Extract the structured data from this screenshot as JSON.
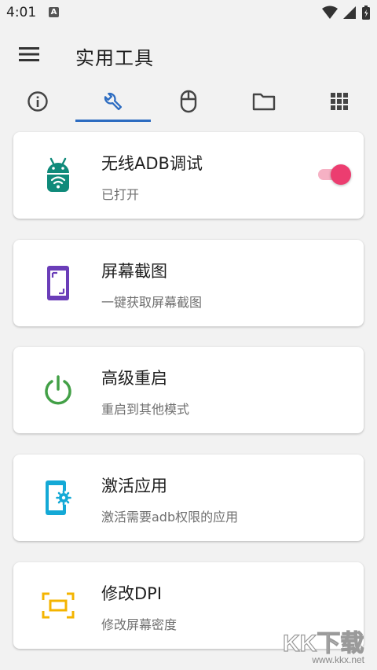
{
  "status_bar": {
    "time": "4:01",
    "notification_letter": "A"
  },
  "app_bar": {
    "title": "实用工具"
  },
  "tabs": [
    {
      "id": "info",
      "icon": "info-icon"
    },
    {
      "id": "tools",
      "icon": "wrench-icon",
      "selected": true
    },
    {
      "id": "mouse",
      "icon": "mouse-icon"
    },
    {
      "id": "files",
      "icon": "folder-icon"
    },
    {
      "id": "apps",
      "icon": "grid-icon"
    }
  ],
  "cards": [
    {
      "title": "无线ADB调试",
      "subtitle": "已打开",
      "icon": "android-wifi-icon",
      "color": "#0f8a7a",
      "toggle_on": true
    },
    {
      "title": "屏幕截图",
      "subtitle": "一键获取屏幕截图",
      "icon": "screenshot-icon",
      "color": "#6a3db8"
    },
    {
      "title": "高级重启",
      "subtitle": "重启到其他模式",
      "icon": "power-icon",
      "color": "#43a047"
    },
    {
      "title": "激活应用",
      "subtitle": "激活需要adb权限的应用",
      "icon": "phone-gear-icon",
      "color": "#14a9d6"
    },
    {
      "title": "修改DPI",
      "subtitle": "修改屏幕密度",
      "icon": "dpi-frame-icon",
      "color": "#f4b400"
    }
  ],
  "colors": {
    "accent": "#2d6cc1",
    "toggle_thumb": "#ec3d70",
    "toggle_track": "#f6b1c4"
  },
  "watermark": {
    "logo_text": "KK下载",
    "url": "www.kkx.net"
  }
}
